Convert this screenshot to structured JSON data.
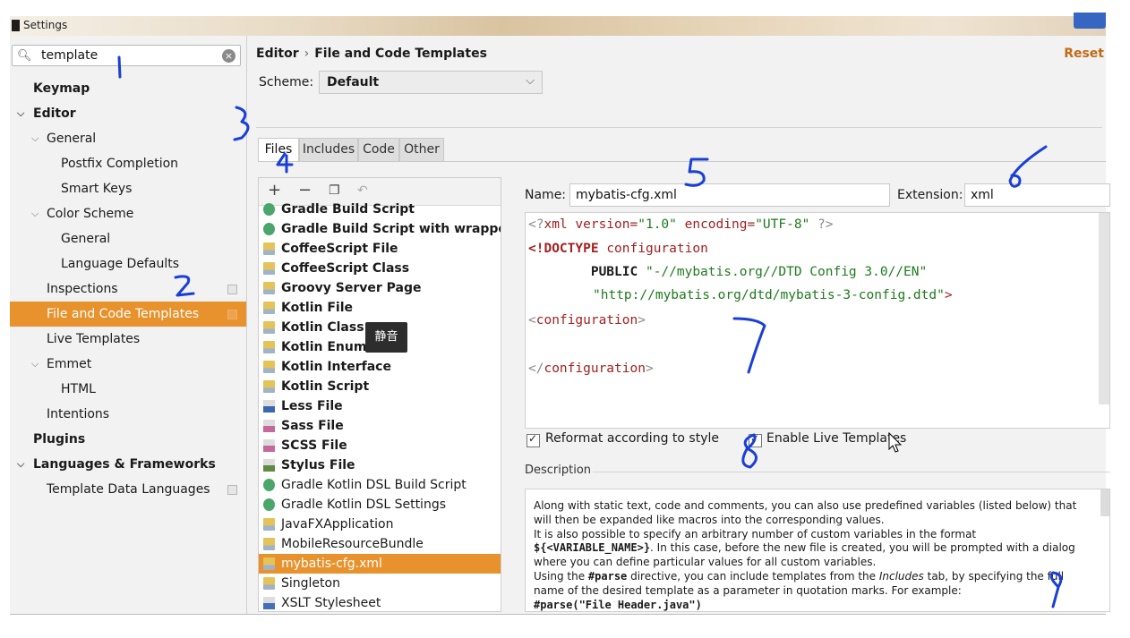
{
  "window": {
    "title": "Settings"
  },
  "search": {
    "value": "template"
  },
  "sidebar": {
    "items": [
      {
        "label": "Keymap"
      },
      {
        "label": "Editor"
      },
      {
        "label": "General"
      },
      {
        "label": "Postfix Completion"
      },
      {
        "label": "Smart Keys"
      },
      {
        "label": "Color Scheme"
      },
      {
        "label": "General"
      },
      {
        "label": "Language Defaults"
      },
      {
        "label": "Inspections"
      },
      {
        "label": "File and Code Templates"
      },
      {
        "label": "Live Templates"
      },
      {
        "label": "Emmet"
      },
      {
        "label": "HTML"
      },
      {
        "label": "Intentions"
      },
      {
        "label": "Plugins"
      },
      {
        "label": "Languages & Frameworks"
      },
      {
        "label": "Template Data Languages"
      }
    ],
    "selected": "File and Code Templates"
  },
  "header": {
    "breadcrumb": [
      "Editor",
      "File and Code Templates"
    ],
    "reset": "Reset"
  },
  "scheme": {
    "label": "Scheme:",
    "value": "Default"
  },
  "tabs": [
    {
      "label": "Files",
      "active": true
    },
    {
      "label": "Includes"
    },
    {
      "label": "Code"
    },
    {
      "label": "Other"
    }
  ],
  "toolbar": {
    "add": "+",
    "remove": "−"
  },
  "templates": [
    {
      "label": "Gradle Build Script",
      "icon": "gradle-icon"
    },
    {
      "label": "Gradle Build Script with wrapper",
      "icon": "gradle-icon"
    },
    {
      "label": "CoffeeScript File",
      "icon": "coffeescript-icon"
    },
    {
      "label": "CoffeeScript Class",
      "icon": "coffeescript-icon"
    },
    {
      "label": "Groovy Server Page",
      "icon": "file-icon"
    },
    {
      "label": "Kotlin File",
      "icon": "kotlin-icon"
    },
    {
      "label": "Kotlin Class",
      "icon": "kotlin-icon"
    },
    {
      "label": "Kotlin Enum",
      "icon": "kotlin-icon"
    },
    {
      "label": "Kotlin Interface",
      "icon": "kotlin-icon"
    },
    {
      "label": "Kotlin Script",
      "icon": "kotlin-icon"
    },
    {
      "label": "Less File",
      "icon": "less-icon"
    },
    {
      "label": "Sass File",
      "icon": "sass-icon"
    },
    {
      "label": "SCSS File",
      "icon": "scss-icon"
    },
    {
      "label": "Stylus File",
      "icon": "stylus-icon"
    },
    {
      "label": "Gradle Kotlin DSL Build Script",
      "icon": "gradle-icon"
    },
    {
      "label": "Gradle Kotlin DSL Settings",
      "icon": "gradle-icon"
    },
    {
      "label": "JavaFXApplication",
      "icon": "file-icon"
    },
    {
      "label": "MobileResourceBundle",
      "icon": "file-icon"
    },
    {
      "label": "mybatis-cfg.xml",
      "icon": "file-icon"
    },
    {
      "label": "Singleton",
      "icon": "file-icon"
    },
    {
      "label": "XSLT Stylesheet",
      "icon": "xslt-icon"
    }
  ],
  "tooltip": "静音",
  "editor": {
    "name_label": "Name:",
    "name_value": "mybatis-cfg.xml",
    "ext_label": "Extension:",
    "ext_value": "xml",
    "code": {
      "l1_a": "<?",
      "l1_b": "xml version=",
      "l1_c": "\"1.0\"",
      "l1_d": " encoding=",
      "l1_e": "\"UTF-8\"",
      "l1_f": " ?>",
      "l2_a": "<!DOCTYPE ",
      "l2_b": "configuration",
      "l3_a": "        PUBLIC ",
      "l3_b": "\"-//mybatis.org//DTD Config 3.0//EN\"",
      "l4_b": "\"http://mybatis.org/dtd/mybatis-3-config.dtd\"",
      "l4_c": ">",
      "l5_a": "<",
      "l5_b": "configuration",
      "l5_c": ">",
      "l7_a": "</",
      "l7_b": "configuration",
      "l7_c": ">"
    },
    "reformat_label": "Reformat according to style",
    "live_templates_label": "Enable Live Templates",
    "description_label": "Description"
  },
  "description": {
    "p1": "Along with static text, code and comments, you can also use predefined variables (listed below) that will then be expanded like macros into the corresponding values.",
    "p2a": "It is also possible to specify an arbitrary number of custom variables in the format",
    "p2b": "${<VARIABLE_NAME>}",
    "p2c": ". In this case, before the new file is created, you will be prompted with a dialog where you can define particular values for all custom variables.",
    "p3a": "Using the ",
    "p3b": "#parse",
    "p3c": " directive, you can include templates from the ",
    "p3d": "Includes",
    "p3e": " tab, by specifying the full name of the desired template as a parameter in quotation marks. For example:",
    "p4": "#parse(\"File Header.java\")"
  },
  "annotations": [
    "1",
    "2",
    "3",
    "4",
    "5",
    "6",
    "7",
    "8",
    "9"
  ]
}
